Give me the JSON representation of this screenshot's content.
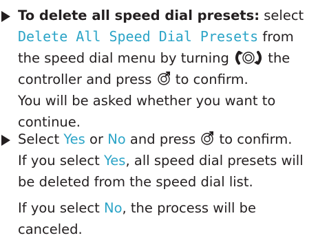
{
  "step1": {
    "heading": "To delete all speed dial presets:",
    "t1": " select ",
    "menu_item": "Delete All Speed Dial Presets",
    "t2": " from the speed dial menu by turning ",
    "t3": " the controller and press ",
    "t4": " to confirm.",
    "sub": "You will be asked whether you want to continue."
  },
  "step2": {
    "t1": "Select ",
    "yes": "Yes",
    "t2": " or ",
    "no": "No",
    "t3": " and press ",
    "t4": " to confirm.",
    "s1a": "If you select ",
    "s1yes": "Yes",
    "s1b": ", all speed dial presets will be deleted from the speed dial list.",
    "s2a": "If you select ",
    "s2no": "No",
    "s2b": ", the process will be canceled."
  },
  "icons": {
    "bullet": "triangle-bullet-icon",
    "controller": "rotate-controller-icon",
    "press": "press-controller-icon"
  },
  "colors": {
    "text": "#231f20",
    "highlight": "#2ba4c7"
  }
}
